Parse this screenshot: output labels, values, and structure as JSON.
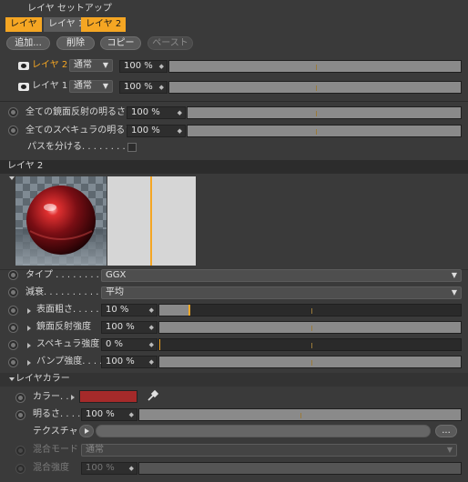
{
  "setup": {
    "title": "レイヤ セットアップ",
    "tabs": [
      "レイヤ",
      "レイヤ 1",
      "レイヤ 2"
    ],
    "buttons": {
      "add": "追加...",
      "delete": "削除",
      "copy": "コピー",
      "paste": "ペースト"
    }
  },
  "layers": [
    {
      "name": "レイヤ 2",
      "mode": "通常",
      "value": "100 %",
      "fraction": 1.0
    },
    {
      "name": "レイヤ 1",
      "mode": "通常",
      "value": "100 %",
      "fraction": 1.0
    }
  ],
  "global": {
    "reflection_brightness": {
      "label": "全ての鏡面反射の明るさ",
      "value": "100 %",
      "fraction": 1.0
    },
    "specular_brightness": {
      "label": "全てのスペキュラの明るさ",
      "value": "100 %",
      "fraction": 1.0
    },
    "separate_pass": {
      "label": "パスを分ける. . . . . . . . ."
    }
  },
  "layer2": {
    "header": "レイヤ 2",
    "type": {
      "label": "タイプ . . . . . . . . .",
      "value": "GGX"
    },
    "attenuation": {
      "label": "減衰. . . . . . . . . .",
      "value": "平均"
    },
    "roughness": {
      "label": "表面粗さ. . . . . .",
      "value": "10 %",
      "fraction": 0.1
    },
    "reflection_strength": {
      "label": "鏡面反射強度",
      "value": "100 %",
      "fraction": 1.0
    },
    "specular_strength": {
      "label": "スペキュラ強度",
      "value": "0 %",
      "fraction": 0.0
    },
    "bump_strength": {
      "label": "バンプ強度. . . .",
      "value": "100 %",
      "fraction": 1.0
    }
  },
  "layer_color": {
    "header": "レイヤカラー",
    "color_label": "カラー. .",
    "color": "#a52a2a",
    "brightness": {
      "label": "明るさ. . . .",
      "value": "100 %",
      "fraction": 1.0
    },
    "texture_label": "テクスチャ",
    "more_button": "...",
    "blend_mode": {
      "label": "混合モード",
      "value": "通常"
    },
    "blend_strength": {
      "label": "混合強度",
      "value": "100 %",
      "fraction": 1.0
    }
  },
  "colors": {
    "accent": "#f5a623",
    "bg": "#3a3a3a"
  }
}
